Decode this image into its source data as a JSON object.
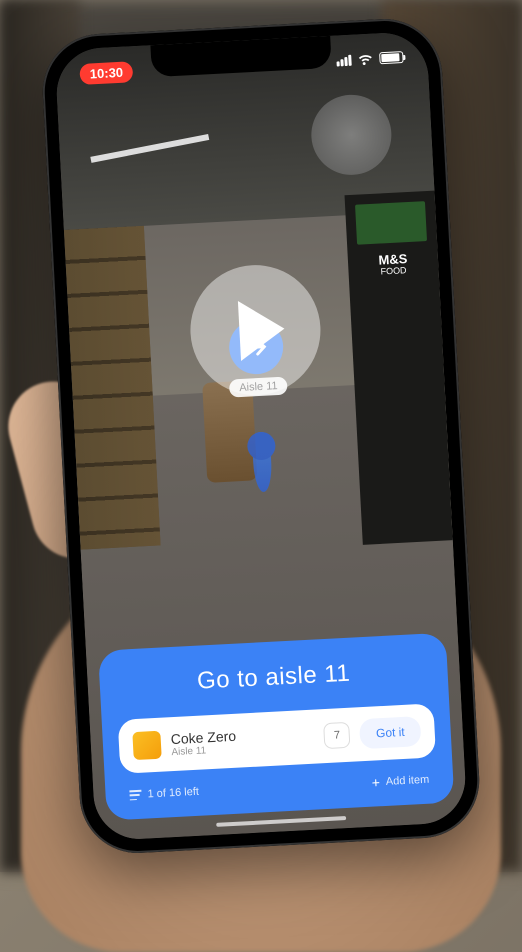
{
  "status": {
    "time": "10:30"
  },
  "ar": {
    "aisle_label": "Aisle 11"
  },
  "store_sign": {
    "line1": "M&S",
    "line2": "FOOD"
  },
  "card": {
    "instruction": "Go to aisle 11",
    "item": {
      "name": "Coke Zero",
      "location": "Aisle 11",
      "quantity": "7"
    },
    "got_it_label": "Got it",
    "progress": "1 of 16 left",
    "add_label": "Add item"
  }
}
